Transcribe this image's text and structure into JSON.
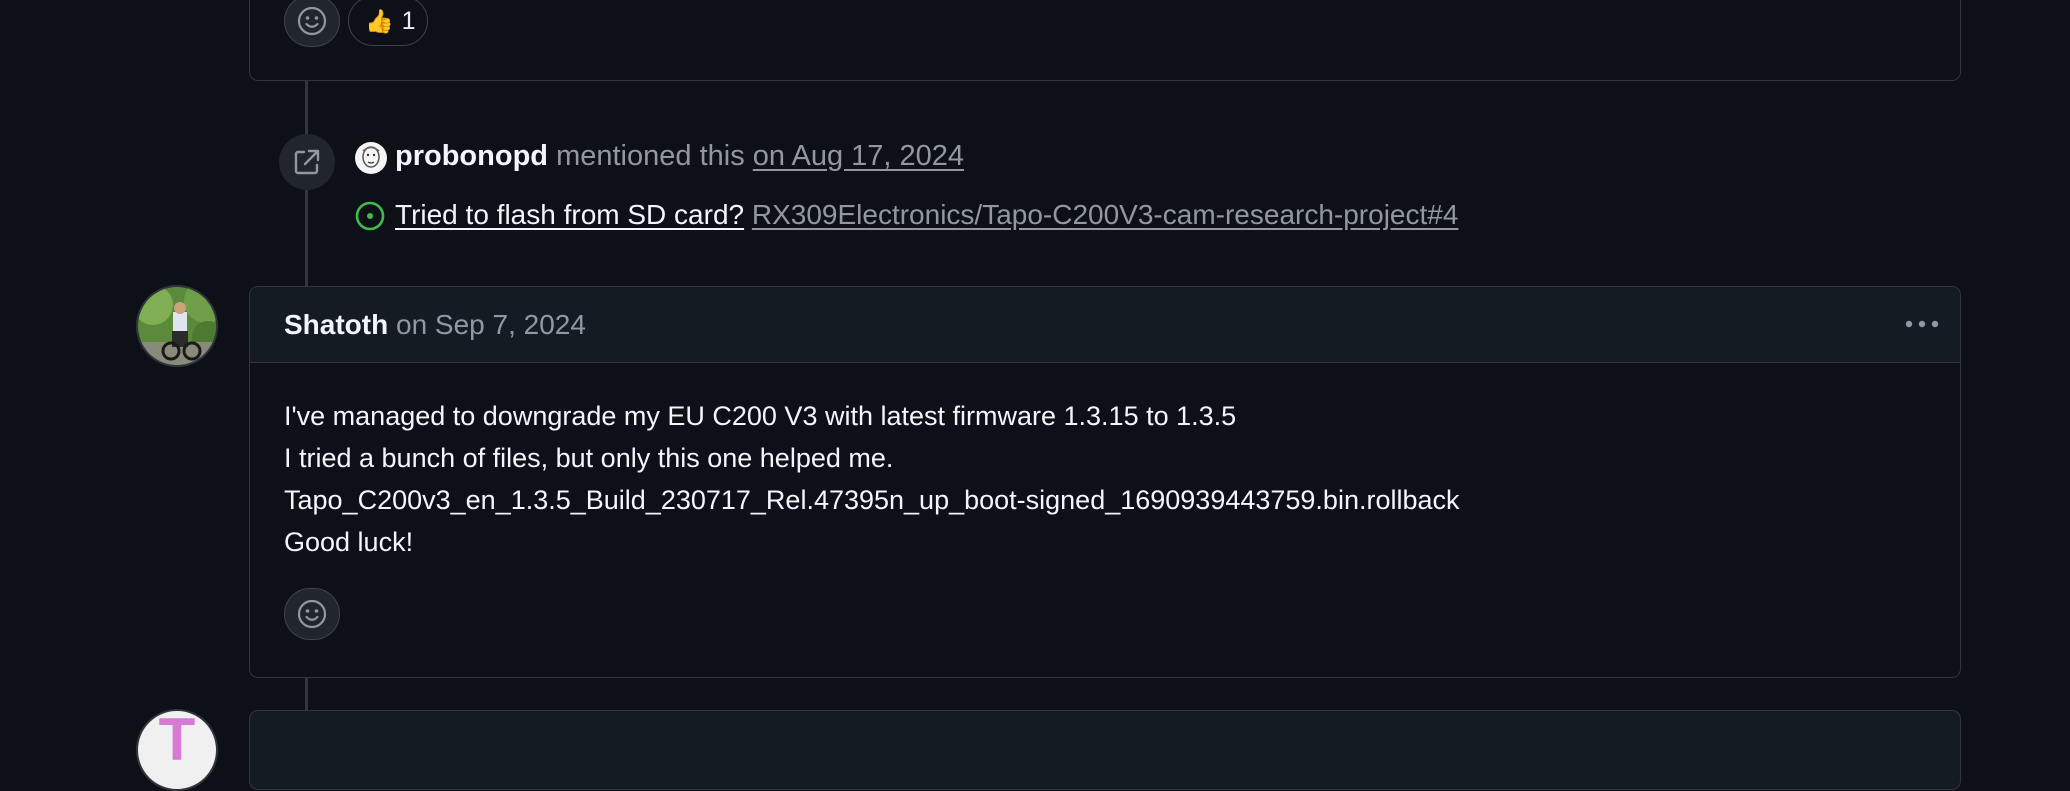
{
  "previous_comment": {
    "reaction": {
      "emoji": "👍",
      "count": "1"
    }
  },
  "mention_event": {
    "author": "probonopd",
    "action": "mentioned this",
    "date": "on Aug 17, 2024",
    "issue_title": "Tried to flash from SD card?",
    "issue_ref": "RX309Electronics/Tapo-C200V3-cam-research-project#4",
    "issue_state_color": "#3fb950"
  },
  "comment": {
    "author": "Shatoth",
    "date": "on Sep 7, 2024",
    "lines": [
      "I've managed to downgrade my EU C200 V3 with latest firmware 1.3.15 to 1.3.5",
      "I tried a bunch of files, but only this one helped me.",
      "Tapo_C200v3_en_1.3.5_Build_230717_Rel.47395n_up_boot-signed_1690939443759.bin.rollback",
      "Good luck!"
    ]
  },
  "next_comment": {
    "avatar_letter": "T",
    "avatar_color": "#d67ad6"
  },
  "colors": {
    "background": "#0d1117",
    "border": "#30363d",
    "muted": "#9198a1",
    "open_green": "#3fb950"
  }
}
